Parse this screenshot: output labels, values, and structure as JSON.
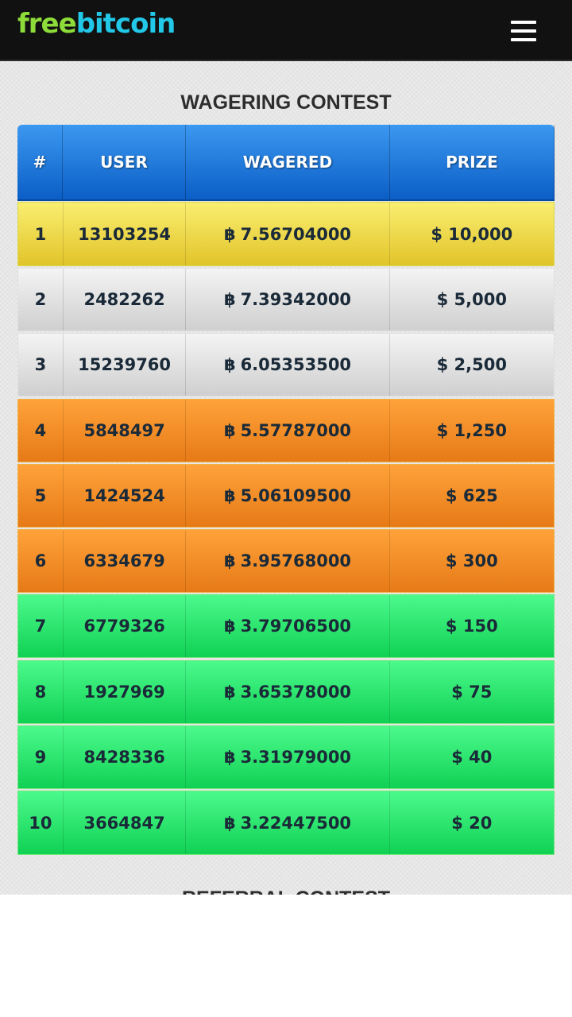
{
  "header": {
    "logo_part1": "free",
    "logo_part2": "bitcoin",
    "menu_icon": "hamburger-icon"
  },
  "wagering_contest": {
    "title": "WAGERING CONTEST",
    "columns": [
      "#",
      "USER",
      "WAGERED",
      "PRIZE"
    ],
    "currency_symbol": "฿",
    "rows": [
      {
        "rank": "1",
        "user": "13103254",
        "wagered": "7.56704000",
        "prize": "$ 10,000",
        "tier": "gold"
      },
      {
        "rank": "2",
        "user": "2482262",
        "wagered": "7.39342000",
        "prize": "$ 5,000",
        "tier": "silver"
      },
      {
        "rank": "3",
        "user": "15239760",
        "wagered": "6.05353500",
        "prize": "$ 2,500",
        "tier": "silver"
      },
      {
        "rank": "4",
        "user": "5848497",
        "wagered": "5.57787000",
        "prize": "$ 1,250",
        "tier": "orange"
      },
      {
        "rank": "5",
        "user": "1424524",
        "wagered": "5.06109500",
        "prize": "$ 625",
        "tier": "orange"
      },
      {
        "rank": "6",
        "user": "6334679",
        "wagered": "3.95768000",
        "prize": "$ 300",
        "tier": "orange"
      },
      {
        "rank": "7",
        "user": "6779326",
        "wagered": "3.79706500",
        "prize": "$ 150",
        "tier": "green"
      },
      {
        "rank": "8",
        "user": "1927969",
        "wagered": "3.65378000",
        "prize": "$ 75",
        "tier": "green"
      },
      {
        "rank": "9",
        "user": "8428336",
        "wagered": "3.31979000",
        "prize": "$ 40",
        "tier": "green"
      },
      {
        "rank": "10",
        "user": "3664847",
        "wagered": "3.22447500",
        "prize": "$ 20",
        "tier": "green"
      }
    ]
  },
  "referral_contest": {
    "title": "REFERRAL CONTEST"
  },
  "colors": {
    "header_bg": "#111111",
    "logo_free": "#8ddc3a",
    "logo_bitcoin": "#22c8e8",
    "table_head": "#1f7ddc",
    "gold": "#f0d840",
    "silver": "#e2e2e2",
    "orange": "#f58f28",
    "green": "#2ae872"
  }
}
